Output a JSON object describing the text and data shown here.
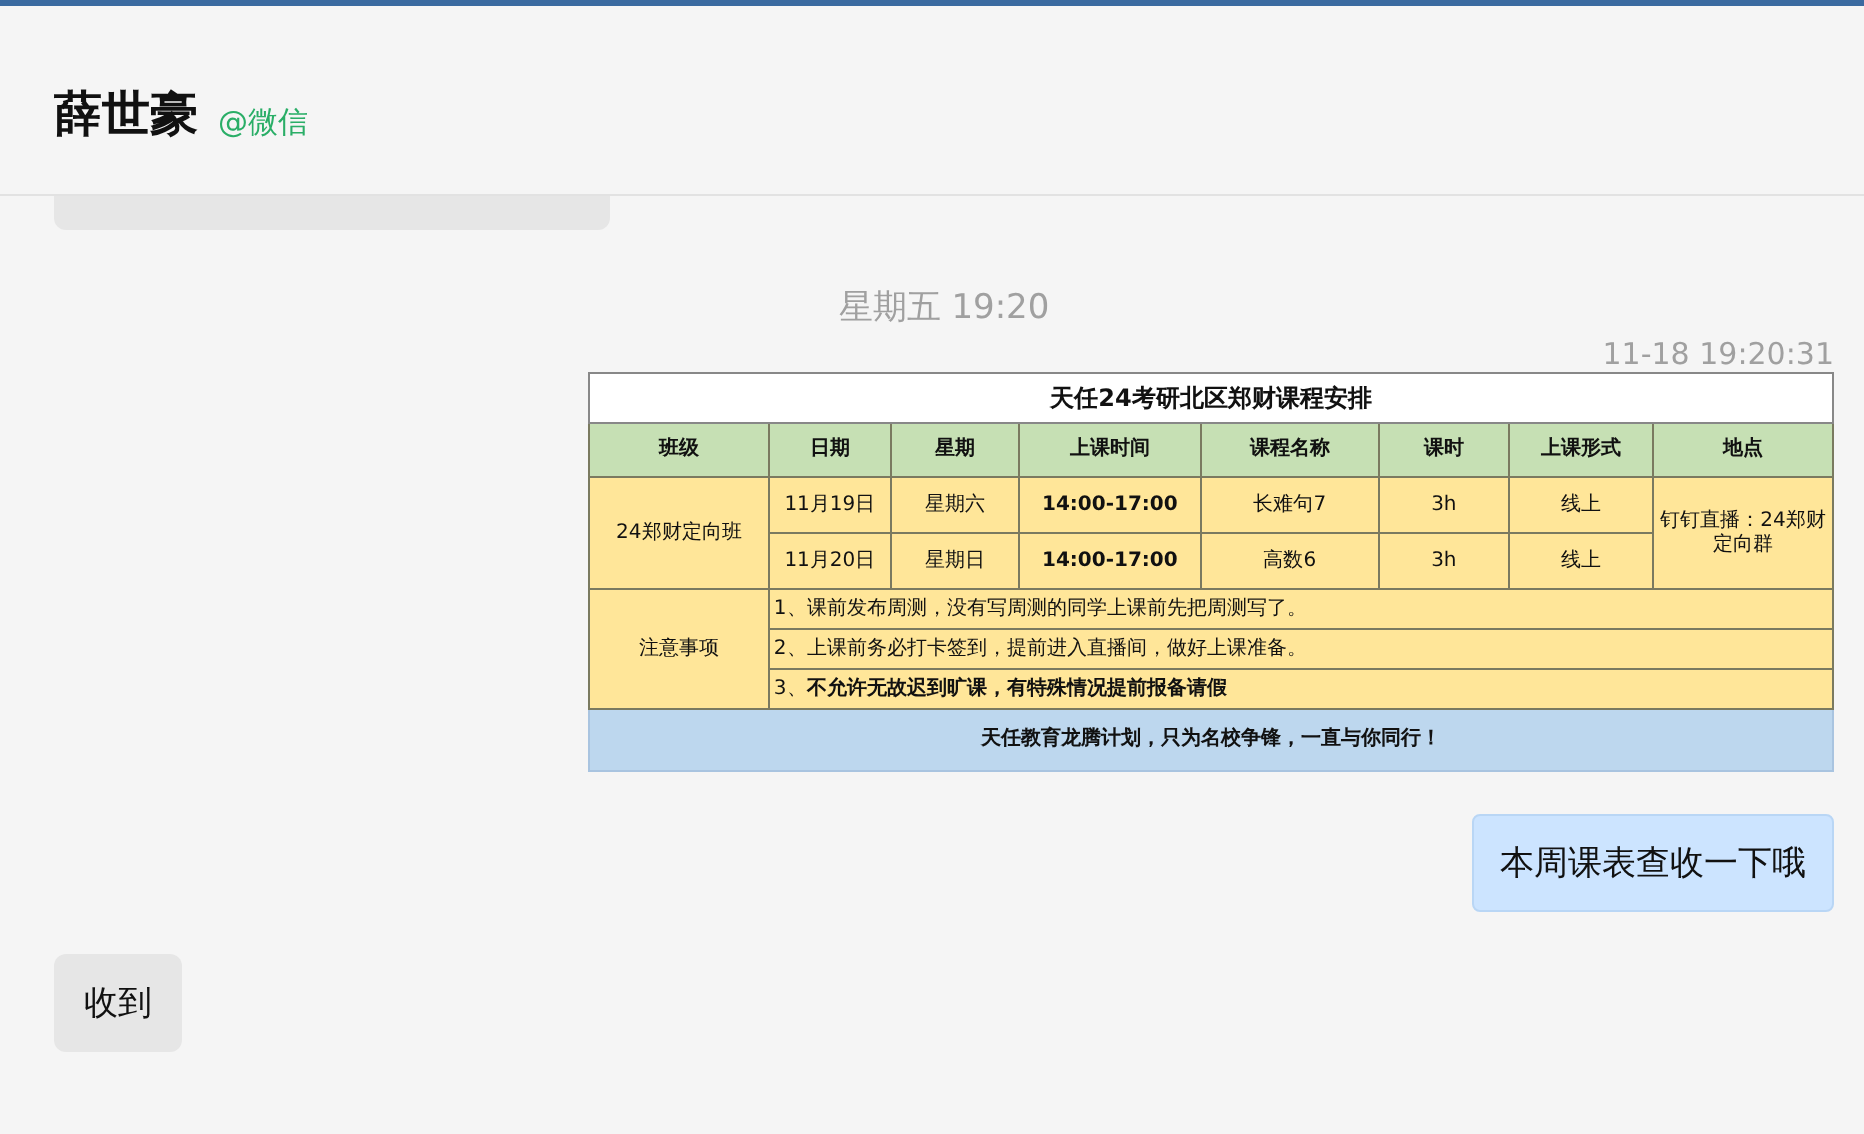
{
  "header": {
    "name": "薛世豪",
    "source": "@微信"
  },
  "messages": [
    {
      "kind": "partial"
    },
    {
      "kind": "date",
      "text": "星期五 19:20"
    },
    {
      "kind": "timestamp",
      "text": "11-18 19:20:31"
    },
    {
      "kind": "schedule",
      "title": "天任24考研北区郑财课程安排",
      "columns": [
        "班级",
        "日期",
        "星期",
        "上课时间",
        "课程名称",
        "课时",
        "上课形式",
        "地点"
      ],
      "class_name": "24郑财定向班",
      "location": "钉钉直播：24郑财定向群",
      "sessions": [
        {
          "date": "11月19日",
          "weekday": "星期六",
          "time": "14:00-17:00",
          "course": "长难句7",
          "hours": "3h",
          "mode": "线上"
        },
        {
          "date": "11月20日",
          "weekday": "星期日",
          "time": "14:00-17:00",
          "course": "高数6",
          "hours": "3h",
          "mode": "线上"
        }
      ],
      "notes_label": "注意事项",
      "notes": [
        "1、课前发布周测，没有写周测的同学上课前先把周测写了。",
        "2、上课前务必打卡签到，提前进入直播间，做好上课准备。",
        "3、**不允许无故迟到旷课，有特殊情况提前报备请假**"
      ],
      "footer": "天任教育龙腾计划，只为名校争锋，一直与你同行！"
    },
    {
      "kind": "sent",
      "text": "本周课表查收一下哦"
    },
    {
      "kind": "received",
      "text": "收到"
    }
  ]
}
